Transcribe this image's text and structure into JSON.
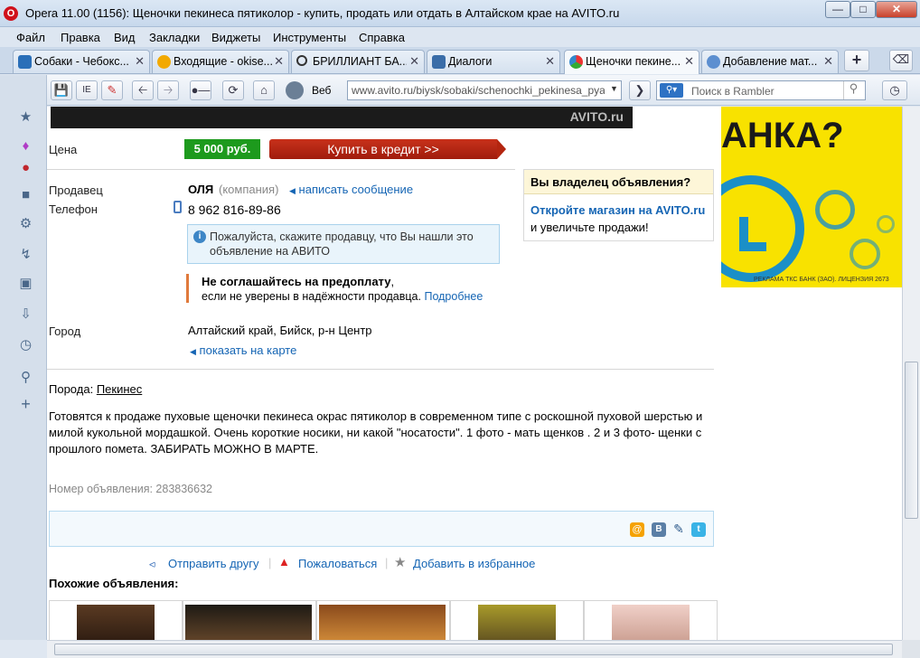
{
  "window": {
    "title": "Opera 11.00 (1156): Щеночки пекинеса пятиколор - купить, продать или отдать в Алтайском крае на AVITO.ru",
    "logo_letter": "O"
  },
  "menu": [
    "Файл",
    "Правка",
    "Вид",
    "Закладки",
    "Виджеты",
    "Инструменты",
    "Справка"
  ],
  "tabs": [
    {
      "label": "Собаки - Чебокс..."
    },
    {
      "label": "Входящие - okise..."
    },
    {
      "label": "БРИЛЛИАНТ БА..."
    },
    {
      "label": "Диалоги"
    },
    {
      "label": "Щеночки пекине..."
    },
    {
      "label": "Добавление мат..."
    }
  ],
  "toolbar": {
    "web_label": "Веб",
    "url": "www.avito.ru/biysk/sobaki/schenochki_pekinesa_pyat",
    "search_placeholder": "Поиск в Rambler",
    "ie_label": "IE"
  },
  "listing": {
    "price_label": "Цена",
    "price": "5 000 руб.",
    "credit_button": "Купить в кредит >>",
    "seller_label": "Продавец",
    "seller_name": "ОЛЯ",
    "seller_type": "(компания)",
    "write_message": "написать сообщение",
    "phone_label": "Телефон",
    "phone": "8 962 816-89-86",
    "notice": "Пожалуйста, скажите продавцу, что Вы нашли это объявление на АВИТО",
    "warning_bold": "Не соглашайтесь на предоплату",
    "warning_comma": ",",
    "warning_text": "если не уверены в надёжности продавца.",
    "warning_link": "Подробнее",
    "city_label": "Город",
    "city": "Алтайский край, Бийск, р-н Центр",
    "show_map": "показать на карте",
    "breed_label": "Порода:",
    "breed": "Пекинес",
    "description": "Готовятся к продаже пуховые щеночки пекинеса окрас пятиколор в современном типе с роскошной пуховой шерстью и милой кукольной мордашкой. Очень короткие носики, ни какой \"носатости\". 1 фото - мать щенков . 2 и 3 фото- щенки с прошлого помета. ЗАБИРАТЬ МОЖНО В МАРТЕ.",
    "ad_number": "Номер объявления: 283836632",
    "send_friend": "Отправить другу",
    "complain": "Пожаловаться",
    "favorite": "Добавить в избранное",
    "similar_title": "Похожие объявления:",
    "image_watermark": "AVITO.ru"
  },
  "owner_box": {
    "title": "Вы владелец объявления?",
    "link": "Откройте магазин на AVITO.ru",
    "text": "и увеличьте продажи!"
  },
  "banner": {
    "headline": "АНКА?",
    "footer": "РЕКЛАМА ТКС БАНК (ЗАО). ЛИЦЕНЗИЯ 2673"
  },
  "share_icons": [
    "mail-icon",
    "vk-icon",
    "livejournal-icon",
    "twitter-icon"
  ],
  "colors": {
    "price_green": "#1d9a1d",
    "credit_red": "#b8220f",
    "link_blue": "#1565b4",
    "banner_yellow": "#f8e200",
    "banner_blue": "#1b8fc7"
  }
}
